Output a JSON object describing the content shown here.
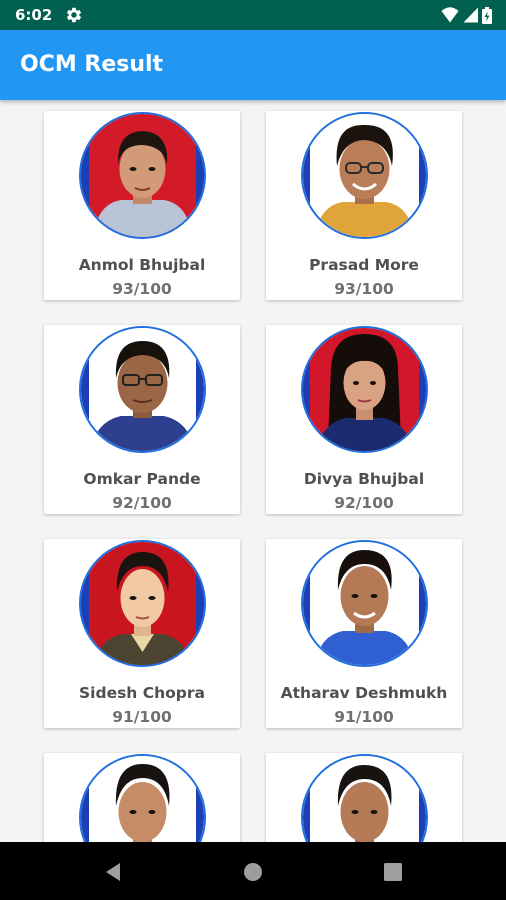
{
  "status_bar": {
    "time": "6:02",
    "background": "#01604f"
  },
  "app_bar": {
    "title": "OCM Result",
    "background": "#2196f3"
  },
  "colors": {
    "photo_border": "#1f6fe0",
    "name_text": "#505050",
    "score_text": "#707070"
  },
  "students": [
    {
      "name": "Anmol Bhujbal",
      "score": "93/100",
      "photo_background": "red"
    },
    {
      "name": "Prasad More",
      "score": "93/100",
      "photo_background": "white"
    },
    {
      "name": "Omkar Pande",
      "score": "92/100",
      "photo_background": "white"
    },
    {
      "name": "Divya Bhujbal",
      "score": "92/100",
      "photo_background": "red"
    },
    {
      "name": "Sidesh Chopra",
      "score": "91/100",
      "photo_background": "red"
    },
    {
      "name": "Atharav Deshmukh",
      "score": "91/100",
      "photo_background": "white"
    },
    {
      "name": "",
      "score": "",
      "photo_background": "white"
    },
    {
      "name": "",
      "score": "",
      "photo_background": "white"
    }
  ],
  "nav_bar": {
    "icons": [
      "back-icon",
      "home-icon",
      "recents-icon"
    ]
  }
}
